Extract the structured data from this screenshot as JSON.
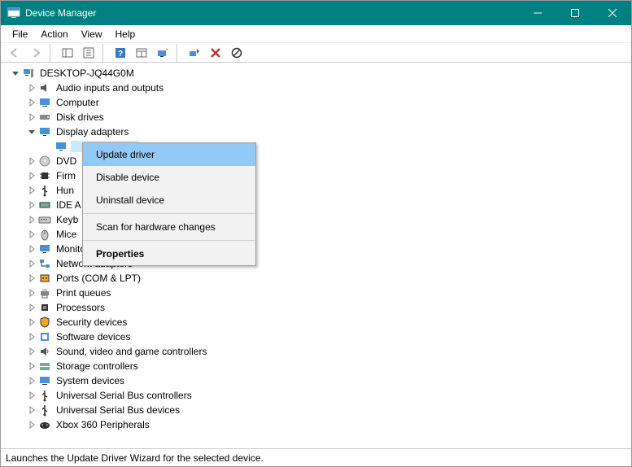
{
  "title": "Device Manager",
  "menus": {
    "file": "File",
    "action": "Action",
    "view": "View",
    "help": "Help"
  },
  "root": "DESKTOP-JQ44G0M",
  "categories": [
    {
      "name": "Audio inputs and outputs",
      "icon": "speaker-icon"
    },
    {
      "name": "Computer",
      "icon": "computer-icon"
    },
    {
      "name": "Disk drives",
      "icon": "disk-icon"
    },
    {
      "name": "Display adapters",
      "icon": "monitor-icon",
      "expanded": true,
      "selected_child": true
    },
    {
      "name": "DVD",
      "icon": "disc-icon"
    },
    {
      "name": "Firm",
      "icon": "chip-icon"
    },
    {
      "name": "Hun",
      "icon": "usb-icon"
    },
    {
      "name": "IDE A",
      "icon": "ide-icon"
    },
    {
      "name": "Keyb",
      "icon": "keyboard-icon"
    },
    {
      "name": "Mice",
      "icon": "mouse-icon"
    },
    {
      "name": "Monitors",
      "icon": "monitor-icon"
    },
    {
      "name": "Network adapters",
      "icon": "network-icon"
    },
    {
      "name": "Ports (COM & LPT)",
      "icon": "port-icon"
    },
    {
      "name": "Print queues",
      "icon": "printer-icon"
    },
    {
      "name": "Processors",
      "icon": "cpu-icon"
    },
    {
      "name": "Security devices",
      "icon": "security-icon"
    },
    {
      "name": "Software devices",
      "icon": "software-icon"
    },
    {
      "name": "Sound, video and game controllers",
      "icon": "sound-icon"
    },
    {
      "name": "Storage controllers",
      "icon": "storage-icon"
    },
    {
      "name": "System devices",
      "icon": "system-icon"
    },
    {
      "name": "Universal Serial Bus controllers",
      "icon": "usb-icon"
    },
    {
      "name": "Universal Serial Bus devices",
      "icon": "usb-icon"
    },
    {
      "name": "Xbox 360 Peripherals",
      "icon": "xbox-icon"
    }
  ],
  "context_menu": {
    "update": "Update driver",
    "disable": "Disable device",
    "uninstall": "Uninstall device",
    "scan": "Scan for hardware changes",
    "properties": "Properties"
  },
  "status": "Launches the Update Driver Wizard for the selected device."
}
